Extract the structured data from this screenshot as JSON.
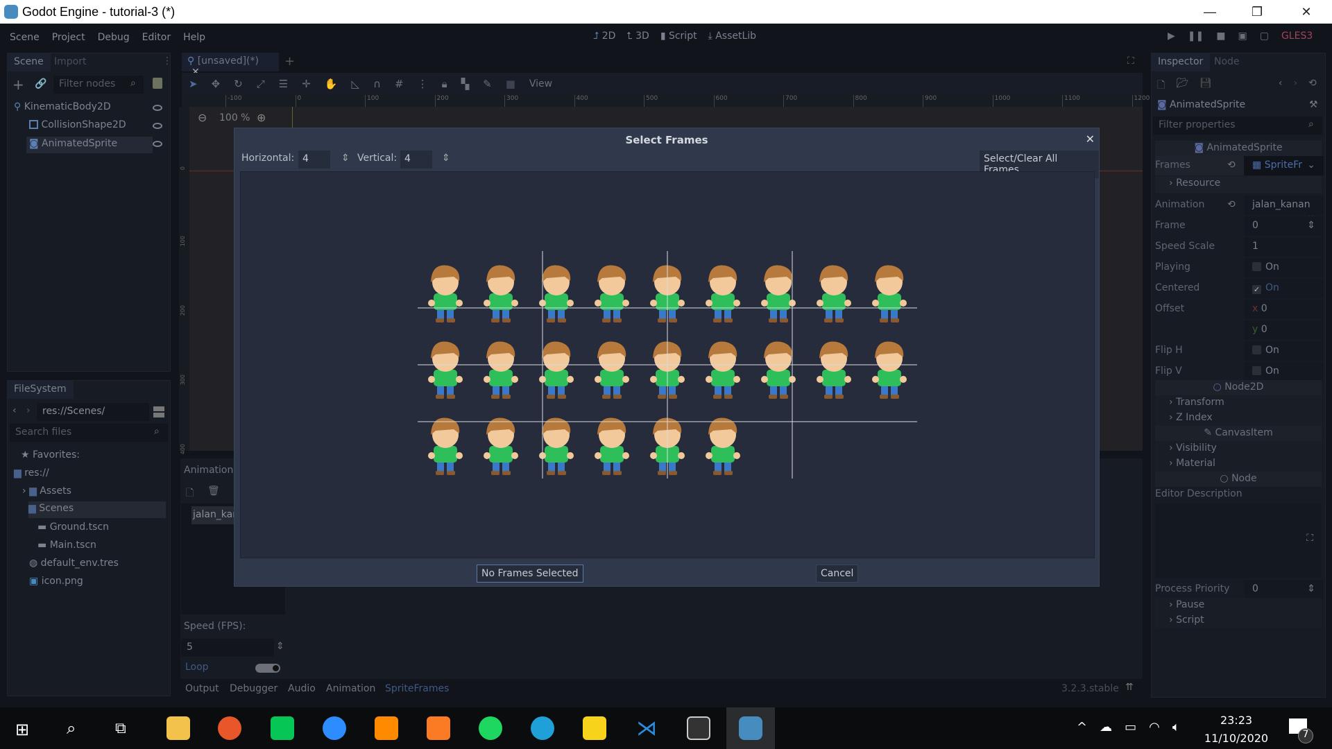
{
  "window": {
    "title": "Godot Engine - tutorial-3 (*)"
  },
  "menu": [
    "Scene",
    "Project",
    "Debug",
    "Editor",
    "Help"
  ],
  "workspaces": [
    "2D",
    "3D",
    "Script",
    "AssetLib"
  ],
  "renderer": "GLES3",
  "scene_dock": {
    "tabs": [
      "Scene",
      "Import"
    ],
    "filter_placeholder": "Filter nodes",
    "nodes": [
      "KinematicBody2D",
      "CollisionShape2D",
      "AnimatedSprite"
    ]
  },
  "filesystem": {
    "tab": "FileSystem",
    "path": "res://Scenes/",
    "search_placeholder": "Search files",
    "items": [
      "Favorites:",
      "res://",
      "Assets",
      "Scenes",
      "Ground.tscn",
      "Main.tscn",
      "default_env.tres",
      "icon.png"
    ]
  },
  "editor": {
    "scene_tab": "[unsaved](*)",
    "view_menu": "View",
    "zoom": "100 %",
    "ruler_ticks": [
      "-100",
      "0",
      "100",
      "200",
      "300",
      "400",
      "500",
      "600",
      "700",
      "800",
      "900",
      "1000",
      "1100",
      "1200"
    ],
    "vruler_ticks": [
      "0",
      "100",
      "200",
      "300",
      "400"
    ]
  },
  "sprite_frames_panel": {
    "animations_label": "Animations:",
    "animation": "jalan_kanan",
    "speed_label": "Speed (FPS):",
    "speed": "5",
    "loop_label": "Loop",
    "loop": true
  },
  "bottom_tabs": [
    "Output",
    "Debugger",
    "Audio",
    "Animation",
    "SpriteFrames"
  ],
  "version": "3.2.3.stable",
  "dialog": {
    "title": "Select Frames",
    "horizontal_label": "Horizontal:",
    "horizontal": "4",
    "vertical_label": "Vertical:",
    "vertical": "4",
    "select_all": "Select/Clear All Frames",
    "status": "No Frames Selected",
    "cancel": "Cancel"
  },
  "inspector": {
    "tabs": [
      "Inspector",
      "Node"
    ],
    "object": "AnimatedSprite",
    "filter_placeholder": "Filter properties",
    "class_header": "AnimatedSprite",
    "frames_label": "Frames",
    "frames_value": "SpriteFr",
    "resource": "Resource",
    "props": [
      {
        "label": "Animation",
        "value": "jalan_kanan"
      },
      {
        "label": "Frame",
        "value": "0"
      },
      {
        "label": "Speed Scale",
        "value": "1"
      },
      {
        "label": "Playing",
        "value": "On",
        "checked": false
      },
      {
        "label": "Centered",
        "value": "On",
        "checked": true
      },
      {
        "label": "Offset",
        "x": "0",
        "y": "0"
      },
      {
        "label": "Flip H",
        "value": "On",
        "checked": false
      },
      {
        "label": "Flip V",
        "value": "On",
        "checked": false
      }
    ],
    "node2d": "Node2D",
    "transform": "Transform",
    "zindex": "Z Index",
    "canvasitem": "CanvasItem",
    "visibility": "Visibility",
    "material": "Material",
    "node": "Node",
    "editor_description": "Editor Description",
    "process_priority_label": "Process Priority",
    "process_priority": "0",
    "pause": "Pause",
    "script": "Script"
  },
  "taskbar": {
    "time": "23:23",
    "date": "11/10/2020",
    "notifications": "7"
  },
  "colors": {
    "accent": "#5e7fb3",
    "dialog_bg": "#2f394b",
    "renderer": "#a0455c"
  }
}
